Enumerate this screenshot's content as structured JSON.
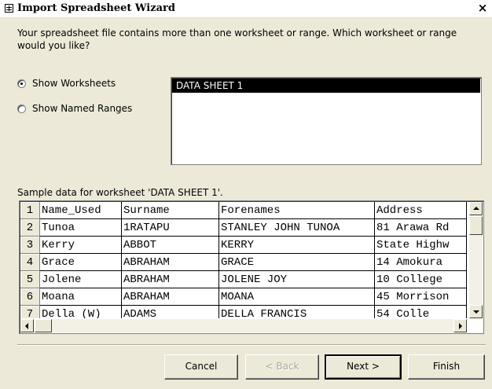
{
  "window": {
    "title": "Import Spreadsheet Wizard",
    "close_glyph": "×"
  },
  "prompt": "Your spreadsheet file contains more than one worksheet or range. Which worksheet or range would you like?",
  "options": [
    {
      "label": "Show Worksheets",
      "selected": true
    },
    {
      "label": "Show Named Ranges",
      "selected": false
    }
  ],
  "sheets": [
    "DATA SHEET 1"
  ],
  "sample_label": "Sample data for worksheet 'DATA SHEET 1'.",
  "grid": {
    "rows": [
      {
        "num": "1",
        "cells": [
          "Name_Used",
          "Surname",
          "Forenames",
          "Address"
        ]
      },
      {
        "num": "2",
        "cells": [
          "Tunoa",
          "1RATAPU",
          "STANLEY JOHN TUNOA",
          "81 Arawa Rd"
        ]
      },
      {
        "num": "3",
        "cells": [
          "Kerry",
          "ABBOT",
          "KERRY",
          "State Highw"
        ]
      },
      {
        "num": "4",
        "cells": [
          "Grace",
          "ABRAHAM",
          "GRACE",
          "14 Amokura"
        ]
      },
      {
        "num": "5",
        "cells": [
          "Jolene",
          "ABRAHAM",
          "JOLENE JOY",
          "10 College"
        ]
      },
      {
        "num": "6",
        "cells": [
          "Moana",
          "ABRAHAM",
          "MOANA",
          "45 Morrison"
        ]
      },
      {
        "num": "7",
        "cells": [
          "Della (W)",
          "ADAMS",
          "DELLA FRANCIS",
          "54 Colle"
        ]
      }
    ]
  },
  "buttons": {
    "cancel": "Cancel",
    "back": "< Back",
    "next": "Next >",
    "finish": "Finish"
  },
  "icons": {
    "window": "spreadsheet-icon",
    "close": "close-icon"
  }
}
